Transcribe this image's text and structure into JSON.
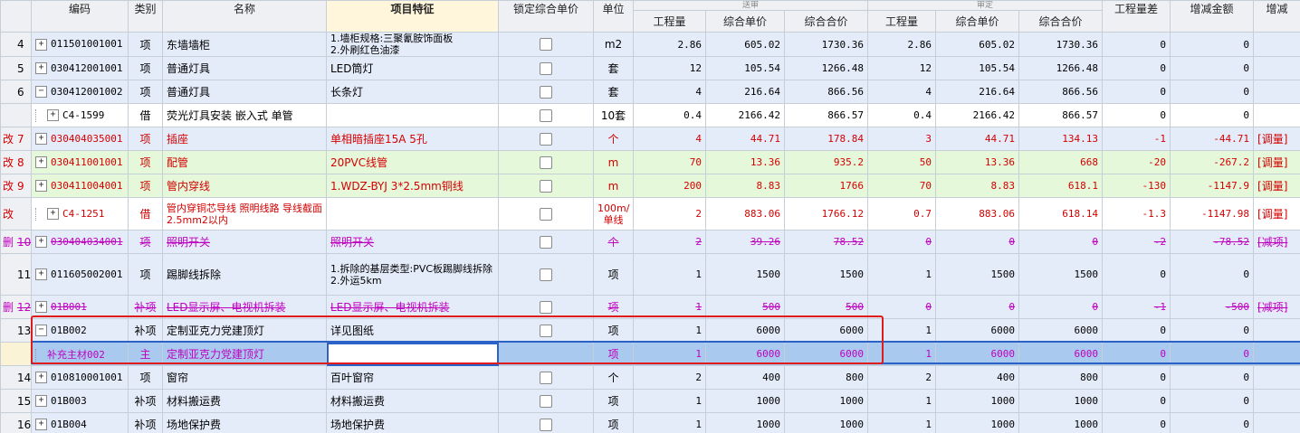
{
  "header": {
    "top_labels": [
      "送审",
      "审定"
    ],
    "columns": {
      "code": "编码",
      "category": "类别",
      "name": "名称",
      "spec": "项目特征",
      "lock": "锁定综合单价",
      "unit": "单位",
      "qty1": "工程量",
      "price1": "综合单价",
      "total1": "综合合价",
      "qty2": "工程量",
      "price2": "综合单价",
      "total2": "综合合价",
      "qty_diff": "工程量差",
      "amount_diff": "增减金额",
      "last": "增减"
    }
  },
  "rows": [
    {
      "label": "4",
      "mark": "",
      "tree": "+",
      "code": "011501001001",
      "cat": "项",
      "name": "东墙墙柜",
      "spec": "1.墙柜规格:三聚氰胺饰面板\n2.外刷红色油漆",
      "unit": "m2",
      "q1": "2.86",
      "p1": "605.02",
      "t1": "1730.36",
      "q2": "2.86",
      "p2": "605.02",
      "t2": "1730.36",
      "qd": "0",
      "ad": "0",
      "note": ""
    },
    {
      "label": "5",
      "mark": "",
      "tree": "+",
      "code": "030412001001",
      "cat": "项",
      "name": "普通灯具",
      "spec": "LED筒灯",
      "unit": "套",
      "q1": "12",
      "p1": "105.54",
      "t1": "1266.48",
      "q2": "12",
      "p2": "105.54",
      "t2": "1266.48",
      "qd": "0",
      "ad": "0",
      "note": ""
    },
    {
      "label": "6",
      "mark": "",
      "tree": "−",
      "code": "030412001002",
      "cat": "项",
      "name": "普通灯具",
      "spec": "长条灯",
      "unit": "套",
      "q1": "4",
      "p1": "216.64",
      "t1": "866.56",
      "q2": "4",
      "p2": "216.64",
      "t2": "866.56",
      "qd": "0",
      "ad": "0",
      "note": ""
    },
    {
      "label": "",
      "mark": "",
      "tree": "+",
      "code": "C4-1599",
      "cat": "借",
      "name": "荧光灯具安装 嵌入式 单管",
      "spec": "",
      "unit": "10套",
      "q1": "0.4",
      "p1": "2166.42",
      "t1": "866.57",
      "q2": "0.4",
      "p2": "2166.42",
      "t2": "866.57",
      "qd": "0",
      "ad": "0",
      "note": ""
    },
    {
      "label": "7",
      "mark": "改",
      "tree": "+",
      "code": "030404035001",
      "cat": "项",
      "name": "插座",
      "spec": "单相暗插座15A 5孔",
      "unit": "个",
      "q1": "4",
      "p1": "44.71",
      "t1": "178.84",
      "q2": "3",
      "p2": "44.71",
      "t2": "134.13",
      "qd": "-1",
      "ad": "-44.71",
      "note": "[调量]"
    },
    {
      "label": "8",
      "mark": "改",
      "tree": "+",
      "code": "030411001001",
      "cat": "项",
      "name": "配管",
      "spec": "20PVC线管",
      "unit": "m",
      "q1": "70",
      "p1": "13.36",
      "t1": "935.2",
      "q2": "50",
      "p2": "13.36",
      "t2": "668",
      "qd": "-20",
      "ad": "-267.2",
      "note": "[调量]"
    },
    {
      "label": "9",
      "mark": "改",
      "tree": "+",
      "code": "030411004001",
      "cat": "项",
      "name": "管内穿线",
      "spec": "1.WDZ-BYJ 3*2.5mm铜线",
      "unit": "m",
      "q1": "200",
      "p1": "8.83",
      "t1": "1766",
      "q2": "70",
      "p2": "8.83",
      "t2": "618.1",
      "qd": "-130",
      "ad": "-1147.9",
      "note": "[调量]"
    },
    {
      "label": "",
      "mark": "改",
      "tree": "+",
      "code": "C4-1251",
      "cat": "借",
      "name": "管内穿铜芯导线 照明线路 导线截面2.5mm2以内",
      "spec": "",
      "unit": "100m/单线",
      "q1": "2",
      "p1": "883.06",
      "t1": "1766.12",
      "q2": "0.7",
      "p2": "883.06",
      "t2": "618.14",
      "qd": "-1.3",
      "ad": "-1147.98",
      "note": "[调量]"
    },
    {
      "label": "10",
      "mark": "删",
      "tree": "+",
      "code": "030404034001",
      "cat": "项",
      "name": "照明开关",
      "spec": "照明开关",
      "unit": "个",
      "q1": "2",
      "p1": "39.26",
      "t1": "78.52",
      "q2": "0",
      "p2": "0",
      "t2": "0",
      "qd": "-2",
      "ad": "-78.52",
      "note": "[减项]"
    },
    {
      "label": "11",
      "mark": "",
      "tree": "+",
      "code": "011605002001",
      "cat": "项",
      "name": "踢脚线拆除",
      "spec": "1.拆除的基层类型:PVC板踢脚线拆除\n2.外运5km",
      "unit": "项",
      "q1": "1",
      "p1": "1500",
      "t1": "1500",
      "q2": "1",
      "p2": "1500",
      "t2": "1500",
      "qd": "0",
      "ad": "0",
      "note": ""
    },
    {
      "label": "12",
      "mark": "删",
      "tree": "+",
      "code": "01B001",
      "cat": "补项",
      "name": "LED显示屏、电视机拆装",
      "spec": "LED显示屏、电视机拆装",
      "unit": "项",
      "q1": "1",
      "p1": "500",
      "t1": "500",
      "q2": "0",
      "p2": "0",
      "t2": "0",
      "qd": "-1",
      "ad": "-500",
      "note": "[减项]"
    },
    {
      "label": "13",
      "mark": "",
      "tree": "−",
      "code": "01B002",
      "cat": "补项",
      "name": "定制亚克力党建顶灯",
      "spec": "详见图纸",
      "unit": "项",
      "q1": "1",
      "p1": "6000",
      "t1": "6000",
      "q2": "1",
      "p2": "6000",
      "t2": "6000",
      "qd": "0",
      "ad": "0",
      "note": ""
    },
    {
      "label": "",
      "mark": "",
      "tree": "",
      "code": "补充主材002",
      "cat": "主",
      "name": "定制亚克力党建顶灯",
      "spec": "",
      "unit": "项",
      "q1": "1",
      "p1": "6000",
      "t1": "6000",
      "q2": "1",
      "p2": "6000",
      "t2": "6000",
      "qd": "0",
      "ad": "0",
      "note": ""
    },
    {
      "label": "14",
      "mark": "",
      "tree": "+",
      "code": "010810001001",
      "cat": "项",
      "name": "窗帘",
      "spec": "百叶窗帘",
      "unit": "个",
      "q1": "2",
      "p1": "400",
      "t1": "800",
      "q2": "2",
      "p2": "400",
      "t2": "800",
      "qd": "0",
      "ad": "0",
      "note": ""
    },
    {
      "label": "15",
      "mark": "",
      "tree": "+",
      "code": "01B003",
      "cat": "补项",
      "name": "材料搬运费",
      "spec": "材料搬运费",
      "unit": "项",
      "q1": "1",
      "p1": "1000",
      "t1": "1000",
      "q2": "1",
      "p2": "1000",
      "t2": "1000",
      "qd": "0",
      "ad": "0",
      "note": ""
    },
    {
      "label": "16",
      "mark": "",
      "tree": "+",
      "code": "01B004",
      "cat": "补项",
      "name": "场地保护费",
      "spec": "场地保护费",
      "unit": "项",
      "q1": "1",
      "p1": "1000",
      "t1": "1000",
      "q2": "1",
      "p2": "1000",
      "t2": "1000",
      "qd": "0",
      "ad": "0",
      "note": ""
    }
  ],
  "colors": {
    "row_blue": "#e4ecfa",
    "row_green": "#e6f8da",
    "row_selected": "#a9c9ef",
    "modified_red": "#d40000",
    "deleted_magenta": "#c000c0",
    "highlight_box": "#e01b1b"
  }
}
